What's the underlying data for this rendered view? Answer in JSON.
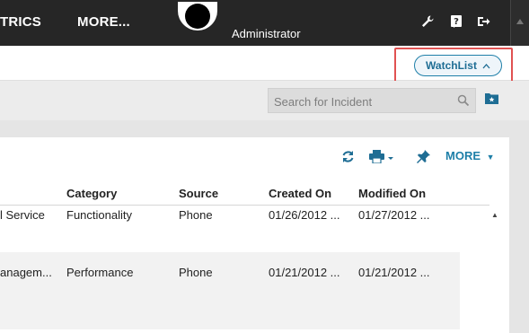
{
  "nav": {
    "items": [
      "TRICS",
      "MORE..."
    ],
    "user_name": "Administrator"
  },
  "watchlist": {
    "label": "WatchList",
    "chevron": "^"
  },
  "search": {
    "placeholder": "Search for Incident",
    "value": ""
  },
  "toolbar": {
    "more_label": "MORE"
  },
  "table": {
    "columns": [
      "Category",
      "Source",
      "Created On",
      "Modified On"
    ],
    "rows": [
      {
        "subject": "l Service",
        "category": "Functionality",
        "source": "Phone",
        "created": "01/26/2012 ...",
        "modified": "01/27/2012 ..."
      },
      {
        "subject": "anagem...",
        "category": "Performance",
        "source": "Phone",
        "created": "01/21/2012 ...",
        "modified": "01/21/2012 ..."
      }
    ]
  },
  "icons": {
    "top": [
      "wrench-icon",
      "help-icon",
      "logout-icon"
    ],
    "toolbar": [
      "refresh-icon",
      "print-icon",
      "pin-icon"
    ],
    "search": "search-icon",
    "folder": "folder-star-icon"
  },
  "colors": {
    "accent": "#1e7fa8",
    "highlight": "#e05252",
    "topbar": "#262626"
  }
}
